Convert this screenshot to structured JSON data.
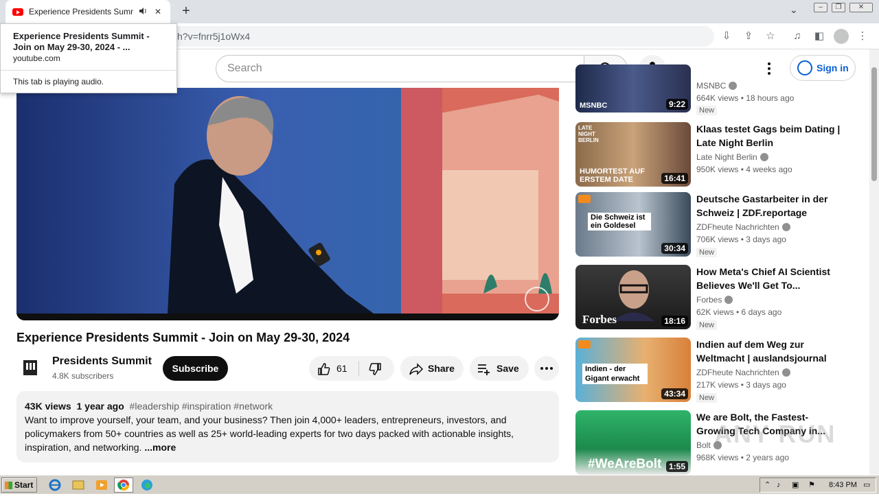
{
  "browser": {
    "tab_title": "Experience Presidents Summit -",
    "url_fragment": "h?v=fnrr5j1oWx4",
    "new_tab_label": "+",
    "hover_card": {
      "title": "Experience Presidents Summit - Join on May 29-30, 2024 - ...",
      "domain": "youtube.com",
      "audio_notice": "This tab is playing audio."
    }
  },
  "youtube": {
    "search_placeholder": "Search",
    "signin_label": "Sign in",
    "video": {
      "title": "Experience Presidents Summit - Join on May 29-30, 2024",
      "channel": "Presidents Summit",
      "subscribers": "4.8K subscribers",
      "subscribe_label": "Subscribe",
      "likes": "61",
      "share_label": "Share",
      "save_label": "Save",
      "views": "43K views",
      "age": "1 year ago",
      "tags": "#leadership #inspiration #network",
      "description": "Want to improve yourself, your team, and your business? Then join 4,000+ leaders, entrepreneurs, investors, and policymakers from 50+ countries as well as 25+ world-leading experts for two days packed with actionable insights, inspiration, and networking.",
      "more_label": "...more"
    },
    "recommendations": [
      {
        "title": "",
        "channel": "MSNBC",
        "meta": "664K views • 18 hours ago",
        "badge": "New",
        "duration": "9:22",
        "thumb_text": "MSNBC"
      },
      {
        "title": "Klaas testet Gags beim Dating | Late Night Berlin",
        "channel": "Late Night Berlin",
        "meta": "950K views • 4 weeks ago",
        "badge": "",
        "duration": "16:41",
        "thumb_text": "HUMORTEST AUF ERSTEM DATE"
      },
      {
        "title": "Deutsche Gastarbeiter in der Schweiz | ZDF.reportage",
        "channel": "ZDFheute Nachrichten",
        "meta": "706K views • 3 days ago",
        "badge": "New",
        "duration": "30:34",
        "thumb_text": "Die Schweiz ist ein Goldesel"
      },
      {
        "title": "How Meta's Chief AI Scientist Believes We'll Get To...",
        "channel": "Forbes",
        "meta": "62K views • 6 days ago",
        "badge": "New",
        "duration": "18:16",
        "thumb_text": "Forbes"
      },
      {
        "title": "Indien auf dem Weg zur Weltmacht | auslandsjournal",
        "channel": "ZDFheute Nachrichten",
        "meta": "217K views • 3 days ago",
        "badge": "New",
        "duration": "43:34",
        "thumb_text": "Indien - der Gigant erwacht"
      },
      {
        "title": "We are Bolt, the Fastest-Growing Tech Company in...",
        "channel": "Bolt",
        "meta": "968K views • 2 years ago",
        "badge": "",
        "duration": "1:55",
        "thumb_text": "#WeAreBolt"
      }
    ]
  },
  "watermark_text": "ANY RUN",
  "taskbar": {
    "start_label": "Start",
    "clock": "8:43 PM"
  },
  "colors": {
    "accent_blue": "#065fd4",
    "youtube_red": "#ff0000",
    "subscribe_bg": "#0f0f0f"
  }
}
